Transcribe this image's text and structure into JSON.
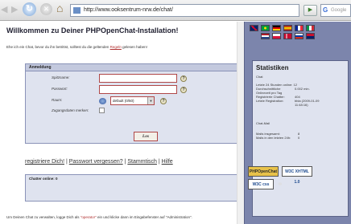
{
  "browser": {
    "url": "http://www.ooksentrum-nrw.de/chat/",
    "search_placeholder": "Google",
    "go_label": "▶"
  },
  "page": {
    "title": "Willkommen zu Deiner PHPOpenChat-Installation!",
    "intro_before": "Ehe ich ein Chat, bevor du ihn betrittst, solltest du die geltenden",
    "intro_link": "Regeln",
    "intro_after": "gelesen haben!",
    "login": {
      "header": "Anmeldung",
      "nick_label": "Spitzname:",
      "password_label": "Passwort:",
      "room_label": "Raum:",
      "room_value": "default (0/50)",
      "guest_label": "Zugangsdaten merken:",
      "submit_label": "Los"
    },
    "links": {
      "register": "registriere Dich!",
      "forgot": "Passwort vergessen?",
      "regulars": "Stammtisch",
      "help": "Hilfe",
      "sep": " | "
    },
    "online_label": "Chatter online: 0",
    "help_text_1": "Um Deinen Chat zu verwalten, logge Dich als",
    "help_text_q": "\"operator\"",
    "help_text_2": "ein und klicke dann im Eingabefenster auf \"Administration\"."
  },
  "sidebar": {
    "stats_title": "Statistiken",
    "chat_label": "Chat",
    "stats": [
      {
        "label": "Letzte 24 Stunden online: 12",
        "value": ""
      },
      {
        "label": "Durchschnittliche",
        "value": "0.002 min."
      },
      {
        "label": "Onlinezeit pro Tag",
        "value": ""
      },
      {
        "label": "Registrierte Chatter:",
        "value": "404"
      },
      {
        "label": "Letzte Registration:",
        "value": "bbia (2009-01-09"
      },
      {
        "label": "",
        "value": "11:48:16)"
      }
    ],
    "mail_label": "Chat-Mail",
    "mail_stats": [
      {
        "label": "Mails insgesamt:",
        "value": "8"
      },
      {
        "label": "Mails in den letzten 24h:",
        "value": "0"
      }
    ],
    "badges": {
      "phpopenchat": "PHPOpenChat",
      "w3c_xhtml": "W3C XHTML 1.0",
      "w3c_css": "W3C css"
    }
  },
  "colors": {
    "sidebar_bg": "#7c85ac",
    "box_bg": "#dfe3ef",
    "input_border": "#b04848"
  }
}
